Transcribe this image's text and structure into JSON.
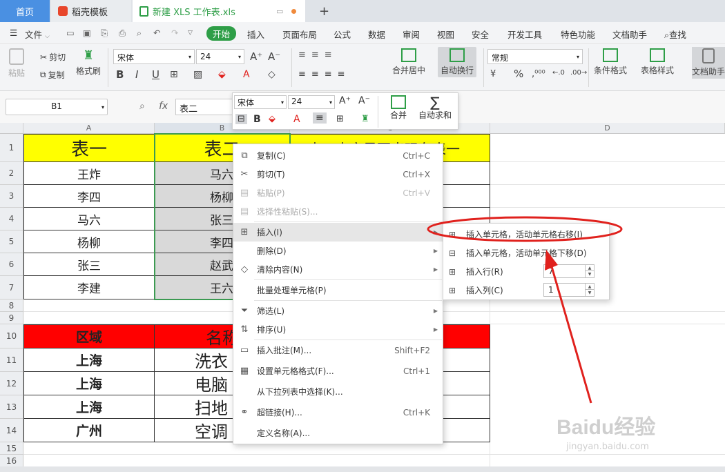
{
  "tabs": {
    "home": "首页",
    "template": "稻壳模板",
    "file": "新建 XLS 工作表.xls",
    "new": "+"
  },
  "menu": {
    "file": "文件",
    "start": "开始",
    "insert": "插入",
    "layout": "页面布局",
    "formula": "公式",
    "data": "数据",
    "review": "审阅",
    "view": "视图",
    "security": "安全",
    "dev": "开发工具",
    "special": "特色功能",
    "doc": "文档助手",
    "find": "查找"
  },
  "ribbon": {
    "paste": "粘贴",
    "cut": "剪切",
    "copy": "复制",
    "format_painter": "格式刷",
    "font": "宋体",
    "size": "24",
    "bold": "B",
    "italic": "I",
    "underline": "U",
    "merge": "合并居中",
    "wrap": "自动换行",
    "number_format": "常规",
    "percent": "%",
    "cond": "条件格式",
    "table_style": "表格样式",
    "doc_helper": "文档助手"
  },
  "formula_bar": {
    "name_box": "B1",
    "fx": "fx",
    "content": "表二"
  },
  "mini_toolbar": {
    "font": "宋体",
    "size": "24",
    "merge": "合并",
    "autosum": "自动求和"
  },
  "columns": [
    "A",
    "B",
    "C",
    "D"
  ],
  "rows": [
    "1",
    "2",
    "3",
    "4",
    "5",
    "6",
    "7",
    "8",
    "9",
    "10",
    "11",
    "12",
    "13",
    "14",
    "15",
    "16"
  ],
  "table1": {
    "header": [
      "表一",
      "表二",
      "表一内容是否出现在表一"
    ],
    "colA": [
      "王炸",
      "李四",
      "马六",
      "杨柳",
      "张三",
      "李建"
    ],
    "colB": [
      "马六",
      "杨柳",
      "张三",
      "李四",
      "赵武",
      "王六"
    ]
  },
  "table2": {
    "header": [
      "区域",
      "名称"
    ],
    "region": [
      "上海",
      "上海",
      "上海",
      "广州"
    ],
    "name": [
      "洗衣",
      "电脑",
      "扫地",
      "空调"
    ]
  },
  "context_menu": [
    {
      "label": "复制(C)",
      "shortcut": "Ctrl+C"
    },
    {
      "label": "剪切(T)",
      "shortcut": "Ctrl+X"
    },
    {
      "label": "粘贴(P)",
      "shortcut": "Ctrl+V"
    },
    {
      "label": "选择性粘贴(S)...",
      "shortcut": ""
    },
    {
      "label": "插入(I)",
      "shortcut": ""
    },
    {
      "label": "删除(D)",
      "shortcut": ""
    },
    {
      "label": "清除内容(N)",
      "shortcut": ""
    },
    {
      "label": "批量处理单元格(P)",
      "shortcut": ""
    },
    {
      "label": "筛选(L)",
      "shortcut": ""
    },
    {
      "label": "排序(U)",
      "shortcut": ""
    },
    {
      "label": "插入批注(M)...",
      "shortcut": "Shift+F2"
    },
    {
      "label": "设置单元格格式(F)...",
      "shortcut": "Ctrl+1"
    },
    {
      "label": "从下拉列表中选择(K)...",
      "shortcut": ""
    },
    {
      "label": "超链接(H)...",
      "shortcut": "Ctrl+K"
    },
    {
      "label": "定义名称(A)...",
      "shortcut": ""
    }
  ],
  "submenu": [
    {
      "label": "插入单元格，活动单元格右移(I)"
    },
    {
      "label": "插入单元格，活动单元格下移(D)"
    },
    {
      "label": "插入行(R)",
      "value": "7"
    },
    {
      "label": "插入列(C)",
      "value": "1"
    }
  ],
  "watermark": {
    "brand": "Baidu经验",
    "url": "jingyan.baidu.com"
  },
  "colors": {
    "accent": "#2e9e47",
    "yellow": "#ffff00",
    "red": "#ff0000",
    "annotation": "#e0211d",
    "selection": "#d9d9d9"
  }
}
